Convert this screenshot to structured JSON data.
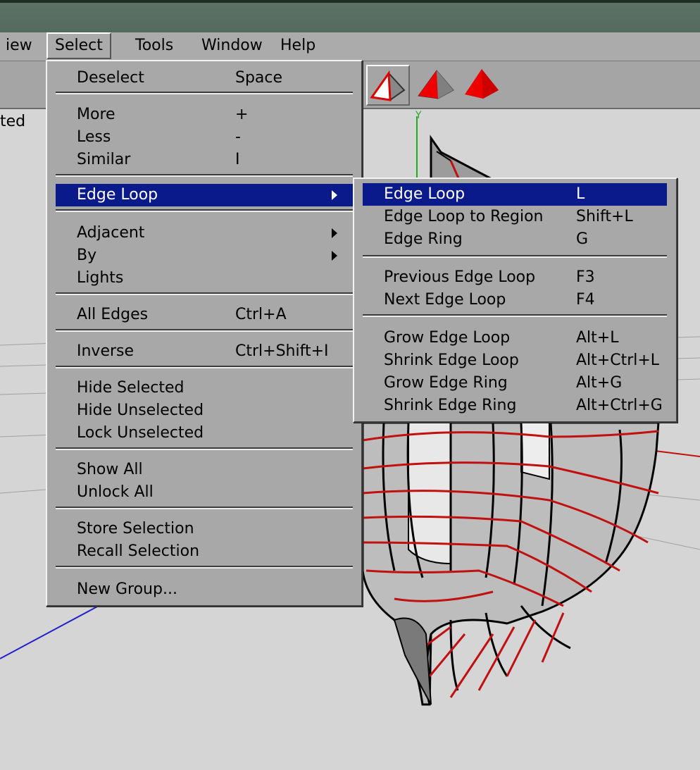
{
  "menubar": {
    "items": [
      {
        "label": "iew"
      },
      {
        "label": "Select"
      },
      {
        "label": "Tools"
      },
      {
        "label": "Window"
      },
      {
        "label": "Help"
      }
    ]
  },
  "toolbar": {
    "icons": [
      "face-select-icon",
      "edge-select-icon",
      "vertex-select-icon"
    ]
  },
  "viewport": {
    "label_fragment": "ted",
    "axis_label": "Y"
  },
  "select_menu": {
    "items": [
      {
        "label": "Deselect",
        "shortcut": "Space"
      },
      {
        "label": "More",
        "shortcut": "+"
      },
      {
        "label": "Less",
        "shortcut": "-"
      },
      {
        "label": "Similar",
        "shortcut": "I"
      },
      {
        "label": "Edge Loop",
        "shortcut": ""
      },
      {
        "label": "Adjacent",
        "shortcut": ""
      },
      {
        "label": "By",
        "shortcut": ""
      },
      {
        "label": "Lights",
        "shortcut": ""
      },
      {
        "label": "All Edges",
        "shortcut": "Ctrl+A"
      },
      {
        "label": "Inverse",
        "shortcut": "Ctrl+Shift+I"
      },
      {
        "label": "Hide Selected",
        "shortcut": ""
      },
      {
        "label": "Hide Unselected",
        "shortcut": ""
      },
      {
        "label": "Lock Unselected",
        "shortcut": ""
      },
      {
        "label": "Show All",
        "shortcut": ""
      },
      {
        "label": "Unlock All",
        "shortcut": ""
      },
      {
        "label": "Store Selection",
        "shortcut": ""
      },
      {
        "label": "Recall Selection",
        "shortcut": ""
      },
      {
        "label": "New Group...",
        "shortcut": ""
      }
    ]
  },
  "edge_loop_submenu": {
    "items": [
      {
        "label": "Edge Loop",
        "shortcut": "L"
      },
      {
        "label": "Edge Loop to Region",
        "shortcut": "Shift+L"
      },
      {
        "label": "Edge Ring",
        "shortcut": "G"
      },
      {
        "label": "Previous Edge Loop",
        "shortcut": "F3"
      },
      {
        "label": "Next Edge Loop",
        "shortcut": "F4"
      },
      {
        "label": "Grow Edge Loop",
        "shortcut": "Alt+L"
      },
      {
        "label": "Shrink Edge Loop",
        "shortcut": "Alt+Ctrl+L"
      },
      {
        "label": "Grow Edge Ring",
        "shortcut": "Alt+G"
      },
      {
        "label": "Shrink Edge Ring",
        "shortcut": "Alt+Ctrl+G"
      }
    ]
  },
  "colors": {
    "highlight": "#0a1a8a",
    "edge_red": "#c01010",
    "axis_green": "#22aa22",
    "axis_blue": "#2222cc"
  }
}
